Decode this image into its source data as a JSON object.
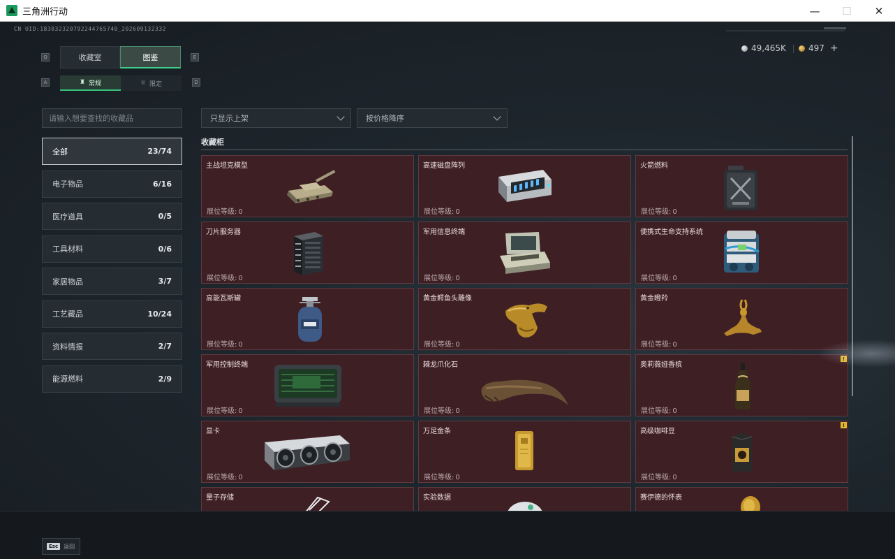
{
  "window": {
    "title": "三角洲行动",
    "minimize_glyph": "—",
    "maximize_glyph": "☐",
    "close_glyph": "✕"
  },
  "uid_text": "CN UID:18303232079224476574​0_202609132332",
  "currency": {
    "silver": "49,465K",
    "gold": "497",
    "add_glyph": "+"
  },
  "tabs": {
    "left_key": "Q",
    "right_key": "E",
    "items": [
      {
        "label": "收藏室",
        "active": false
      },
      {
        "label": "图鉴",
        "active": true
      }
    ]
  },
  "subtabs": {
    "left_key": "A",
    "right_key": "D",
    "items": [
      {
        "label": "常规",
        "icon": "figure-icon",
        "glyph": "♜",
        "active": true
      },
      {
        "label": "限定",
        "icon": "crown-icon",
        "glyph": "♕",
        "active": false
      }
    ]
  },
  "search": {
    "placeholder": "请输入想要查找的收藏品"
  },
  "filters": {
    "listed_only": "只显示上架",
    "sort": "按价格降序"
  },
  "categories": [
    {
      "label": "全部",
      "count": "23/74",
      "active": true
    },
    {
      "label": "电子物品",
      "count": "6/16",
      "active": false
    },
    {
      "label": "医疗道具",
      "count": "0/5",
      "active": false
    },
    {
      "label": "工具材料",
      "count": "0/6",
      "active": false
    },
    {
      "label": "家居物品",
      "count": "3/7",
      "active": false
    },
    {
      "label": "工艺藏品",
      "count": "10/24",
      "active": false
    },
    {
      "label": "资料情报",
      "count": "2/7",
      "active": false
    },
    {
      "label": "能源燃料",
      "count": "2/9",
      "active": false
    }
  ],
  "section_title": "收藏柜",
  "level_label": "展位等级:",
  "items": [
    {
      "name": "主战坦克模型",
      "level": "0",
      "icon": "tank-icon",
      "warn": false
    },
    {
      "name": "高速磁盘阵列",
      "level": "0",
      "icon": "disk-array-icon",
      "warn": false
    },
    {
      "name": "火箭燃料",
      "level": "0",
      "icon": "fuel-canister-icon",
      "warn": false
    },
    {
      "name": "刀片服务器",
      "level": "0",
      "icon": "server-icon",
      "warn": false
    },
    {
      "name": "军用信息终端",
      "level": "0",
      "icon": "terminal-case-icon",
      "warn": false
    },
    {
      "name": "便携式生命支持系统",
      "level": "0",
      "icon": "life-support-icon",
      "warn": false
    },
    {
      "name": "高能瓦斯罐",
      "level": "0",
      "icon": "gas-tank-icon",
      "warn": false
    },
    {
      "name": "黄金鳄鱼头雕像",
      "level": "0",
      "icon": "crocodile-statue-icon",
      "warn": false
    },
    {
      "name": "黄金瞪羚",
      "level": "0",
      "icon": "gazelle-statue-icon",
      "warn": false
    },
    {
      "name": "军用控制终端",
      "level": "0",
      "icon": "control-terminal-icon",
      "warn": false
    },
    {
      "name": "棘龙爪化石",
      "level": "0",
      "icon": "claw-fossil-icon",
      "warn": false
    },
    {
      "name": "奥莉薇娅香槟",
      "level": "0",
      "icon": "champagne-icon",
      "warn": true
    },
    {
      "name": "显卡",
      "level": "0",
      "icon": "graphics-card-icon",
      "warn": false
    },
    {
      "name": "万足金条",
      "level": "0",
      "icon": "gold-bar-icon",
      "warn": false
    },
    {
      "name": "高级咖啡豆",
      "level": "0",
      "icon": "coffee-bag-icon",
      "warn": true
    },
    {
      "name": "量子存储",
      "level": "",
      "icon": "quantum-storage-icon",
      "warn": false
    },
    {
      "name": "实验数据",
      "level": "",
      "icon": "data-disc-icon",
      "warn": false
    },
    {
      "name": "赛伊德的怀表",
      "level": "",
      "icon": "pocket-watch-icon",
      "warn": false
    }
  ],
  "warn_glyph": "!",
  "back": {
    "key": "Esc",
    "label": "返回"
  },
  "colors": {
    "accent_green": "#3fd08a",
    "card_bg": "#3e1f24",
    "warn_yellow": "#e4b82c"
  }
}
